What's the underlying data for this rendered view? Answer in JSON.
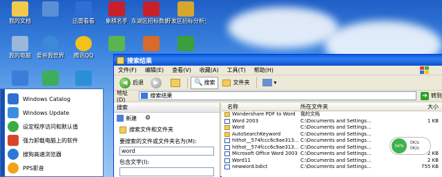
{
  "desktop_icons": [
    {
      "label": "我的文档",
      "color": "#f1c94c"
    },
    {
      "label": "",
      "color": "#5a8fd8"
    },
    {
      "label": "迅雷看看",
      "color": "#2d6fd2"
    },
    {
      "label": "象棋名手",
      "color": "#c8202a"
    },
    {
      "label": "东湖区招标数据一代",
      "color": "#c8202a"
    },
    {
      "label": "开发区招标分析交易客户端",
      "color": "#d8a62a"
    },
    {
      "label": "我的电脑",
      "color": "#9ab7dc"
    },
    {
      "label": "爱帝我世界",
      "color": "#3b8ad8"
    },
    {
      "label": "腾讯QQ",
      "color": "#f0c21a"
    },
    {
      "label": "",
      "color": "#5bb54f"
    },
    {
      "label": "",
      "color": "#d86a2a"
    },
    {
      "label": "",
      "color": "#3b9d3b"
    },
    {
      "label": "",
      "color": "#3b7dd8"
    },
    {
      "label": "",
      "color": "#3cae5c"
    },
    {
      "label": "",
      "color": "#2b8ed8"
    }
  ],
  "start_menu": {
    "items": [
      {
        "label": "Windows Catalog",
        "color": "#2d6fd2"
      },
      {
        "label": "Windows Update",
        "color": "#3a8ee0"
      },
      {
        "label": "设定程序访问和默认值",
        "color": "#3cab46"
      },
      {
        "label": "强力卸载电脑上的软件",
        "color": "#d8462a"
      },
      {
        "label": "搜狗高速浏览器",
        "color": "#2b7ad8"
      },
      {
        "label": "PPS影音",
        "color": "#f0a31a"
      }
    ]
  },
  "window": {
    "title": "搜索结果",
    "menus": [
      "文件(F)",
      "编辑(E)",
      "查看(V)",
      "收藏(A)",
      "工具(T)",
      "帮助(H)"
    ],
    "toolbar": {
      "back": "后退",
      "search": "搜索",
      "folders": "文件夹"
    },
    "address": {
      "label": "地址(D)",
      "value": "搜索结果",
      "go": "转到"
    }
  },
  "search_pane": {
    "title": "搜索",
    "new_button": "新建",
    "search_type": "搜索文件和文件夹",
    "name_label": "要搜索的文件或文件夹名为(M):",
    "name_value": "word",
    "contains_label": "包含文字(I):",
    "contains_value": ""
  },
  "file_list": {
    "columns": {
      "name": "名称",
      "folder": "所在文件夹",
      "size": "大小"
    },
    "rows": [
      {
        "name": "Wondershare PDF to Word",
        "folder": "我的文档",
        "size": "",
        "type": "folder"
      },
      {
        "name": "Word 2003",
        "folder": "C:\\Documents and Settings...",
        "size": "1 KB",
        "type": "doc"
      },
      {
        "name": "Word",
        "folder": "C:\\Documents and Settings...",
        "size": "",
        "type": "folder"
      },
      {
        "name": "AutoSearchKeyword",
        "folder": "C:\\Documents and Settings...",
        "size": "",
        "type": "folder"
      },
      {
        "name": "hithot__574fccc6c9ae313...",
        "folder": "C:\\Documents and Settings...",
        "size": "",
        "type": "doc"
      },
      {
        "name": "hithot__574fccc6c9ae313...",
        "folder": "C:\\Documents and Settings...",
        "size": "",
        "type": "doc"
      },
      {
        "name": "Microsoft Office Word 2003",
        "folder": "C:\\Documents and Settings...",
        "size": "2 KB",
        "type": "doc"
      },
      {
        "name": "Word11",
        "folder": "C:\\Documents and Settings...",
        "size": "2 KB",
        "type": "doc"
      },
      {
        "name": "newword.bdict",
        "folder": "C:\\Documents and Settings...",
        "size": "755 KB",
        "type": "doc"
      }
    ]
  },
  "net_widget": {
    "percent": "56%",
    "up": "0K/s",
    "down": "0K/s"
  }
}
